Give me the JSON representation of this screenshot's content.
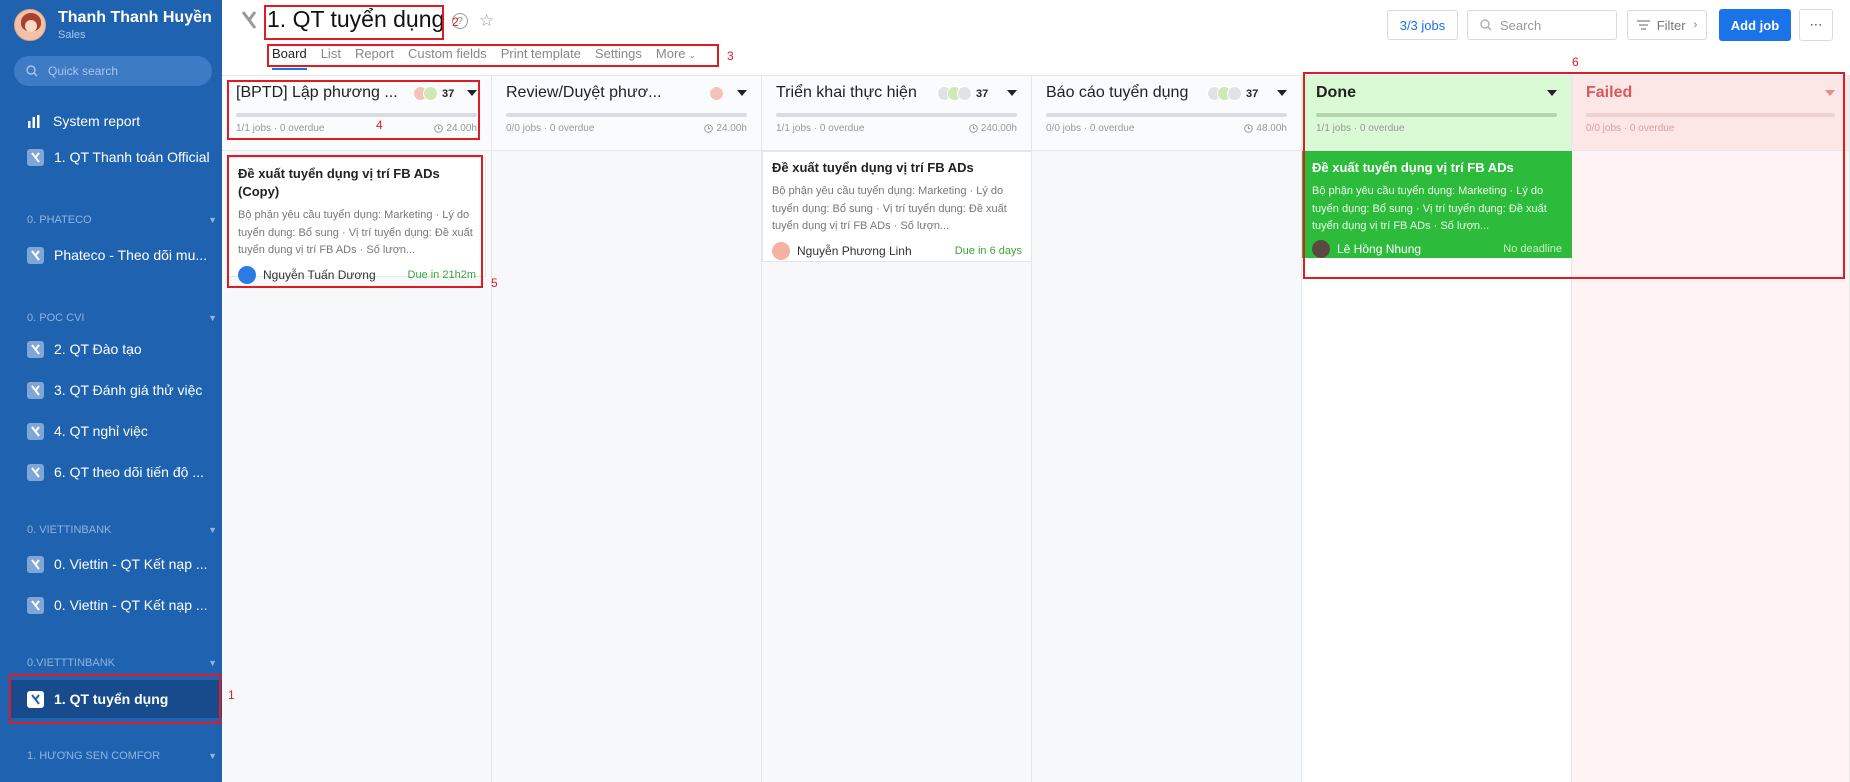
{
  "user": {
    "name": "Thanh Thanh Huyền",
    "role": "Sales"
  },
  "sidebar": {
    "search_placeholder": "Quick search",
    "items": [
      {
        "label": "System report",
        "icon": "bar-chart-icon"
      },
      {
        "label": "1. QT Thanh toán Official",
        "icon": "process-icon"
      }
    ],
    "sections": [
      {
        "label": "0. PHATECO",
        "items": [
          "Phateco - Theo dõi mu..."
        ]
      },
      {
        "label": "0. POC CVI",
        "items": [
          "2. QT Đào tạo",
          "3. QT Đánh giá thử việc",
          "4. QT nghỉ việc",
          "6. QT theo dõi tiến độ ..."
        ]
      },
      {
        "label": "0. VIETTINBANK",
        "items": [
          "0. Viettin - QT Kết nạp ...",
          "0. Viettin - QT Kết nạp ..."
        ]
      },
      {
        "label": "0.VIETTTINBANK",
        "items": [
          "1. QT tuyển dụng"
        ]
      },
      {
        "label": "1. HƯƠNG SEN COMFOR",
        "items": []
      }
    ]
  },
  "header": {
    "title": "1. QT tuyển dụng",
    "tabs": [
      "Board",
      "List",
      "Report",
      "Custom fields",
      "Print template",
      "Settings",
      "More"
    ],
    "jobs_count": "3/3 jobs",
    "search_placeholder": "Search",
    "filter_label": "Filter",
    "add_job_label": "Add job"
  },
  "columns": [
    {
      "title": "[BPTD] Lập phương ...",
      "count": "37",
      "meta": "1/1 jobs · 0 overdue",
      "time": "24.00h"
    },
    {
      "title": "Review/Duyệt phươ...",
      "count": "",
      "meta": "0/0 jobs · 0 overdue",
      "time": "24.00h"
    },
    {
      "title": "Triển khai thực hiện",
      "count": "37",
      "meta": "1/1 jobs · 0 overdue",
      "time": "240.00h"
    },
    {
      "title": "Báo cáo tuyển dụng",
      "count": "37",
      "meta": "0/0 jobs · 0 overdue",
      "time": "48.00h"
    },
    {
      "title": "Done",
      "meta": "1/1 jobs · 0 overdue"
    },
    {
      "title": "Failed",
      "meta": "0/0 jobs · 0 overdue"
    }
  ],
  "cards": [
    {
      "title": "Đề xuất tuyển dụng vị trí FB ADs (Copy)",
      "desc": "Bộ phận yêu cầu tuyển dụng: Marketing · Lý do tuyển dụng: Bổ sung · Vị trí tuyển dụng: Đề xuất tuyển dụng vị trí FB ADs · Số lượn...",
      "user": "Nguyễn Tuấn Dương",
      "due": "Due in 21h2m"
    },
    {
      "title": "Đề xuất tuyển dụng vị trí FB ADs",
      "desc": "Bộ phận yêu cầu tuyển dụng: Marketing · Lý do tuyển dụng: Bổ sung · Vị trí tuyển dụng: Đề xuất tuyển dụng vị trí FB ADs · Số lượn...",
      "user": "Nguyễn Phương Linh",
      "due": "Due in 6 days"
    },
    {
      "title": "Đề xuất tuyển dụng vị trí FB ADs",
      "desc": "Bộ phận yêu cầu tuyển dụng: Marketing · Lý do tuyển dụng: Bổ sung · Vị trí tuyển dụng: Đề xuất tuyển dụng vị trí FB ADs · Số lượn...",
      "user": "Lê Hồng Nhung",
      "due": "No deadline"
    }
  ],
  "annotations": [
    "1",
    "2",
    "3",
    "4",
    "5",
    "6"
  ],
  "colors": {
    "sidebar": "#1f63b0",
    "accent": "#1a73e8",
    "done": "#2dbb3c",
    "failed": "#d45b5b",
    "annotation": "#e01b24"
  }
}
